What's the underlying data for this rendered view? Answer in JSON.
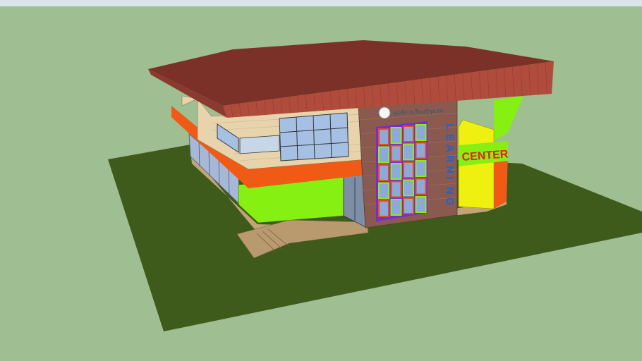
{
  "scene": {
    "sign_thai": "ศูนย์การเรียนรู้ชุมชน",
    "sign_vertical": "LEARNING",
    "sign_horizontal": "CENTER"
  },
  "colors": {
    "sky": "#d9e4ec",
    "background": "#9fbe91",
    "ground": "#3e5b1b",
    "roof_top": "#7b3128",
    "roof_front": "#b04c3c",
    "wall_beige": "#e8d4ac",
    "band_orange": "#f05a14",
    "wall_lime": "#86f012",
    "brick": "#8a5a50",
    "glass": "#8ea8d8",
    "yellow": "#f0f010",
    "letters_blue": "#1f64c8",
    "letters_red": "#e0201a"
  }
}
